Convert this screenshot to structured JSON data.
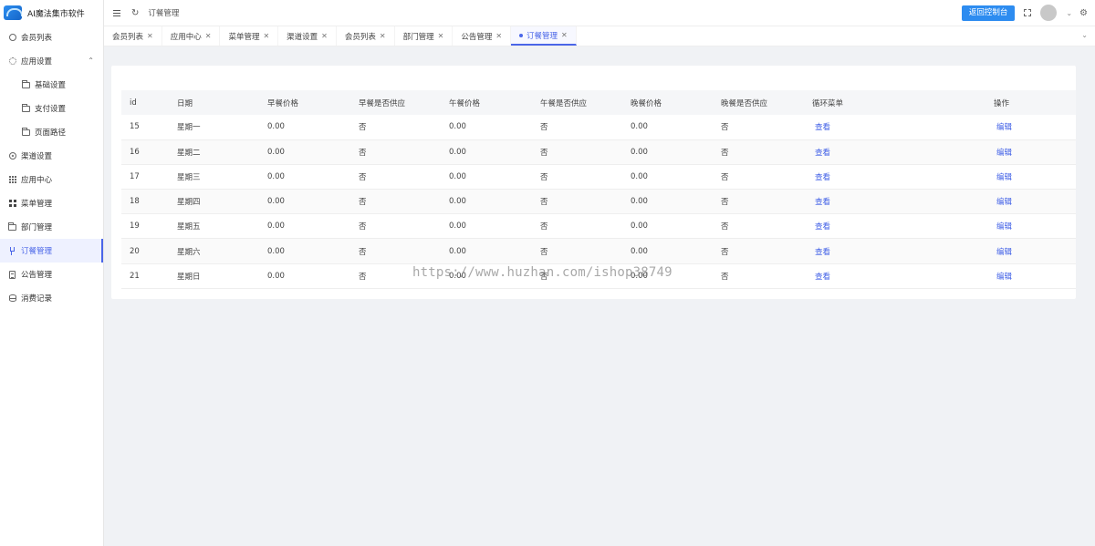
{
  "app": {
    "title": "AI魔法集市软件"
  },
  "sidebar": {
    "items": [
      {
        "label": "会员列表",
        "icon": "user-circle-icon",
        "level": 1
      },
      {
        "label": "应用设置",
        "icon": "gear-icon",
        "level": 1,
        "expanded": true
      },
      {
        "label": "基础设置",
        "icon": "folder-icon",
        "level": 2
      },
      {
        "label": "支付设置",
        "icon": "folder-icon",
        "level": 2
      },
      {
        "label": "页面路径",
        "icon": "folder-icon",
        "level": 2
      },
      {
        "label": "渠道设置",
        "icon": "compass-icon",
        "level": 1
      },
      {
        "label": "应用中心",
        "icon": "grid-icon",
        "level": 1
      },
      {
        "label": "菜单管理",
        "icon": "blocks-icon",
        "level": 1
      },
      {
        "label": "部门管理",
        "icon": "folder-icon",
        "level": 1
      },
      {
        "label": "订餐管理",
        "icon": "fork-knife-icon",
        "level": 1,
        "active": true
      },
      {
        "label": "公告管理",
        "icon": "document-icon",
        "level": 1
      },
      {
        "label": "消费记录",
        "icon": "database-icon",
        "level": 1
      }
    ]
  },
  "header": {
    "breadcrumb": "订餐管理",
    "back_button": "返回控制台"
  },
  "tabs": [
    {
      "label": "会员列表"
    },
    {
      "label": "应用中心"
    },
    {
      "label": "菜单管理"
    },
    {
      "label": "渠道设置"
    },
    {
      "label": "会员列表"
    },
    {
      "label": "部门管理"
    },
    {
      "label": "公告管理"
    },
    {
      "label": "订餐管理",
      "active": true
    }
  ],
  "table": {
    "columns": [
      "id",
      "日期",
      "早餐价格",
      "早餐是否供应",
      "午餐价格",
      "午餐是否供应",
      "晚餐价格",
      "晚餐是否供应",
      "循环菜单",
      "操作"
    ],
    "rows": [
      {
        "id": "15",
        "day": "星期一",
        "breakfast_price": "0.00",
        "breakfast_supply": "否",
        "lunch_price": "0.00",
        "lunch_supply": "否",
        "dinner_price": "0.00",
        "dinner_supply": "否",
        "menu_link": "查看",
        "action": "编辑"
      },
      {
        "id": "16",
        "day": "星期二",
        "breakfast_price": "0.00",
        "breakfast_supply": "否",
        "lunch_price": "0.00",
        "lunch_supply": "否",
        "dinner_price": "0.00",
        "dinner_supply": "否",
        "menu_link": "查看",
        "action": "编辑"
      },
      {
        "id": "17",
        "day": "星期三",
        "breakfast_price": "0.00",
        "breakfast_supply": "否",
        "lunch_price": "0.00",
        "lunch_supply": "否",
        "dinner_price": "0.00",
        "dinner_supply": "否",
        "menu_link": "查看",
        "action": "编辑"
      },
      {
        "id": "18",
        "day": "星期四",
        "breakfast_price": "0.00",
        "breakfast_supply": "否",
        "lunch_price": "0.00",
        "lunch_supply": "否",
        "dinner_price": "0.00",
        "dinner_supply": "否",
        "menu_link": "查看",
        "action": "编辑"
      },
      {
        "id": "19",
        "day": "星期五",
        "breakfast_price": "0.00",
        "breakfast_supply": "否",
        "lunch_price": "0.00",
        "lunch_supply": "否",
        "dinner_price": "0.00",
        "dinner_supply": "否",
        "menu_link": "查看",
        "action": "编辑"
      },
      {
        "id": "20",
        "day": "星期六",
        "breakfast_price": "0.00",
        "breakfast_supply": "否",
        "lunch_price": "0.00",
        "lunch_supply": "否",
        "dinner_price": "0.00",
        "dinner_supply": "否",
        "menu_link": "查看",
        "action": "编辑"
      },
      {
        "id": "21",
        "day": "星期日",
        "breakfast_price": "0.00",
        "breakfast_supply": "否",
        "lunch_price": "0.00",
        "lunch_supply": "否",
        "dinner_price": "0.00",
        "dinner_supply": "否",
        "menu_link": "查看",
        "action": "编辑"
      }
    ]
  },
  "watermark": "https://www.huzhan.com/ishop38749",
  "colors": {
    "accent": "#4a66e8",
    "button": "#2d8cf0",
    "background": "#f0f2f5"
  }
}
